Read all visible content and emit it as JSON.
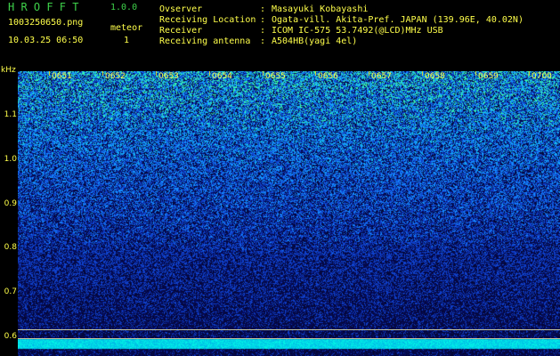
{
  "header": {
    "app_title": "H R O F F T",
    "version": "1.0.0",
    "filename": "1003250650.png",
    "datetime": "10.03.25 06:50",
    "meteor_label": "meteor",
    "meteor_count": "1",
    "info_labels": [
      "Ovserver",
      "Receiving Location",
      "Receiver",
      "Receiving antenna"
    ],
    "info_seps": [
      ":",
      ":",
      ":",
      ":"
    ],
    "info_values": [
      "Masayuki Kobayashi",
      "Ogata-vill. Akita-Pref. JAPAN (139.96E, 40.02N)",
      "ICOM IC-575 53.7492(@LCD)MHz USB",
      "A504HB(yagi 4el)"
    ]
  },
  "plot": {
    "y_unit": "kHz",
    "y_ticks": [
      "1.1",
      "1.0",
      "0.9",
      "0.8",
      "0.7",
      "0.6"
    ],
    "x_ticks": [
      "0651",
      "0652",
      "0653",
      "0654",
      "0655",
      "0656",
      "0657",
      "0658",
      "0659",
      "0700"
    ]
  },
  "colors": {
    "text_green": "#3ed14a",
    "text_yellow": "#ffff4a",
    "background": "#000000",
    "spectrum_high": "#2affa0",
    "spectrum_mid": "#1a5cff",
    "spectrum_low": "#0a0a60"
  }
}
